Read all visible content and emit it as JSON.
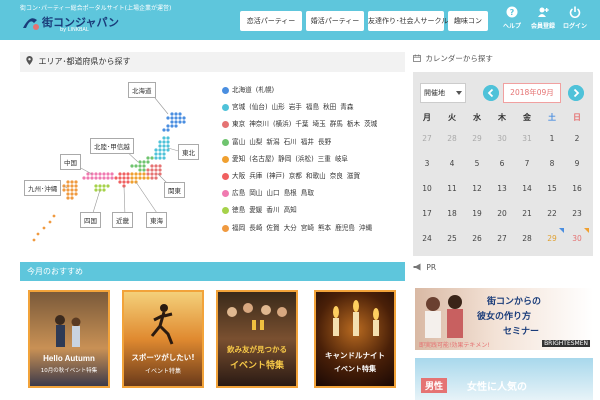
{
  "header": {
    "tagline": "街コン･パーティー総合ポータルサイト(上場企業が運営)",
    "logo_text": "街コンジャパン",
    "logo_sub": "by LINKBAL",
    "nav": [
      "恋活パーティー",
      "婚活パーティー",
      "友達作り･社会人サークル",
      "趣味コン"
    ],
    "icons": [
      {
        "label": "ヘルプ",
        "icon": "question-icon"
      },
      {
        "label": "会員登録",
        "icon": "user-plus-icon"
      },
      {
        "label": "ログイン",
        "icon": "power-icon"
      }
    ]
  },
  "area": {
    "heading": "エリア･都道府県から探す",
    "regions": [
      "北海道",
      "東北",
      "関東",
      "北陸･甲信越",
      "中国",
      "九州･沖縄",
      "四国",
      "近畿",
      "東海"
    ],
    "prefectures": [
      {
        "color": "#4a8ee0",
        "names": [
          "北海道",
          "(札幌)"
        ]
      },
      {
        "color": "#4fc2d9",
        "names": [
          "宮城",
          "(仙台)",
          "山形",
          "岩手",
          "福島",
          "秋田",
          "青森"
        ]
      },
      {
        "color": "#e57373",
        "names": [
          "東京",
          "神奈川",
          "(横浜)",
          "千葉",
          "埼玉",
          "群馬",
          "栃木",
          "茨城"
        ]
      },
      {
        "color": "#6fc46f",
        "names": [
          "富山",
          "山梨",
          "新潟",
          "石川",
          "福井",
          "長野"
        ]
      },
      {
        "color": "#f0a030",
        "names": [
          "愛知",
          "(名古屋)",
          "静岡",
          "(浜松)",
          "三重",
          "岐阜"
        ]
      },
      {
        "color": "#f06060",
        "names": [
          "大阪",
          "兵庫",
          "(神戸)",
          "京都",
          "和歌山",
          "奈良",
          "滋賀"
        ]
      },
      {
        "color": "#f07ab0",
        "names": [
          "広島",
          "岡山",
          "山口",
          "島根",
          "鳥取"
        ]
      },
      {
        "color": "#a6d24a",
        "names": [
          "徳島",
          "愛媛",
          "香川",
          "高知"
        ]
      },
      {
        "color": "#f09a40",
        "names": [
          "福岡",
          "長崎",
          "佐賀",
          "大分",
          "宮崎",
          "熊本",
          "鹿児島",
          "沖縄"
        ]
      }
    ]
  },
  "calendar": {
    "heading": "カレンダーから探す",
    "location_value": "開催地",
    "month": "2018年09月",
    "weekdays": [
      "月",
      "火",
      "水",
      "木",
      "金",
      "土",
      "日"
    ],
    "weeks": [
      [
        "27",
        "28",
        "29",
        "30",
        "31",
        "1",
        "2"
      ],
      [
        "3",
        "4",
        "5",
        "6",
        "7",
        "8",
        "9"
      ],
      [
        "10",
        "11",
        "12",
        "13",
        "14",
        "15",
        "16"
      ],
      [
        "17",
        "18",
        "19",
        "20",
        "21",
        "22",
        "23"
      ],
      [
        "24",
        "25",
        "26",
        "27",
        "28",
        "29",
        "30"
      ]
    ]
  },
  "recommend": {
    "heading": "今月のおすすめ",
    "cards": [
      {
        "title": "Hello Autumn",
        "sub": "10月の秋イベント特集"
      },
      {
        "title": "スポーツがしたい!",
        "sub": "イベント特集"
      },
      {
        "title": "飲み友が見つかる",
        "sub": "イベント特集"
      },
      {
        "title": "キャンドルナイト",
        "sub": "イベント特集"
      }
    ]
  },
  "pr": {
    "heading": "PR",
    "banner1_lines": [
      "街コンからの",
      "彼女の作り方",
      "セミナー"
    ],
    "banner1_note": "即実践可能!効果テキメン!",
    "banner1_brand": "BRIGHTESMEN",
    "banner2_badge": "男性",
    "banner2_text": "女性に人気の"
  }
}
